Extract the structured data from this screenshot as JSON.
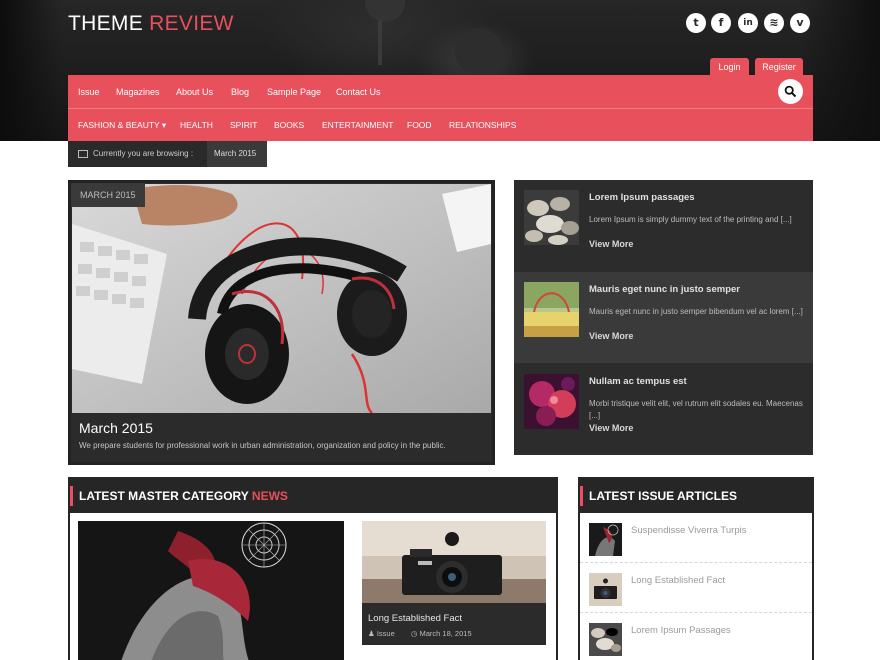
{
  "site": {
    "logo_main": "THEME",
    "logo_accent": "REVIEW"
  },
  "social": [
    {
      "icon": "twitter-icon",
      "glyph": "t"
    },
    {
      "icon": "facebook-icon",
      "glyph": "f"
    },
    {
      "icon": "linkedin-icon",
      "glyph": "in"
    },
    {
      "icon": "rss-icon",
      "glyph": "≋"
    },
    {
      "icon": "vine-icon",
      "glyph": "v"
    }
  ],
  "auth": {
    "login": "Login",
    "register": "Register"
  },
  "nav": {
    "top": [
      "Issue",
      "Magazines",
      "About Us",
      "Blog",
      "Sample Page",
      "Contact Us"
    ],
    "categories": [
      "FASHION & BEAUTY ▾",
      "HEALTH",
      "SPIRIT",
      "BOOKS",
      "ENTERTAINMENT",
      "FOOD",
      "RELATIONSHIPS"
    ]
  },
  "breadcrumb": {
    "label": "Currently you are browsing :",
    "value": "March 2015"
  },
  "featured": {
    "badge": "March 2015",
    "title": "March 2015",
    "description": "We prepare students for professional work in urban administration, organization and policy in the public."
  },
  "side_posts": [
    {
      "title": "Lorem Ipsum passages",
      "excerpt": "Lorem Ipsum is simply dummy text of the printing and [...]",
      "more": "View More"
    },
    {
      "title": "Mauris eget nunc in justo semper",
      "excerpt": "Mauris eget nunc in justo semper bibendum vel ac lorem [...]",
      "more": "View More"
    },
    {
      "title": "Nullam ac tempus est",
      "excerpt": "Morbi tristique velit elit, vel rutrum elit sodales eu. Maecenas [...]",
      "more": "View More"
    }
  ],
  "latest_category": {
    "title_main": "LATEST MASTER CATEGORY",
    "title_accent": "NEWS",
    "card": {
      "title": "Long Established Fact",
      "category": "Issue",
      "date": "March 18, 2015"
    }
  },
  "latest_issue": {
    "title": "LATEST ISSUE ARTICLES",
    "items": [
      "Suspendisse Viverra Turpis",
      "Long Established Fact",
      "Lorem Ipsum Passages"
    ]
  },
  "colors": {
    "accent": "#e8505b",
    "dark": "#262626"
  }
}
